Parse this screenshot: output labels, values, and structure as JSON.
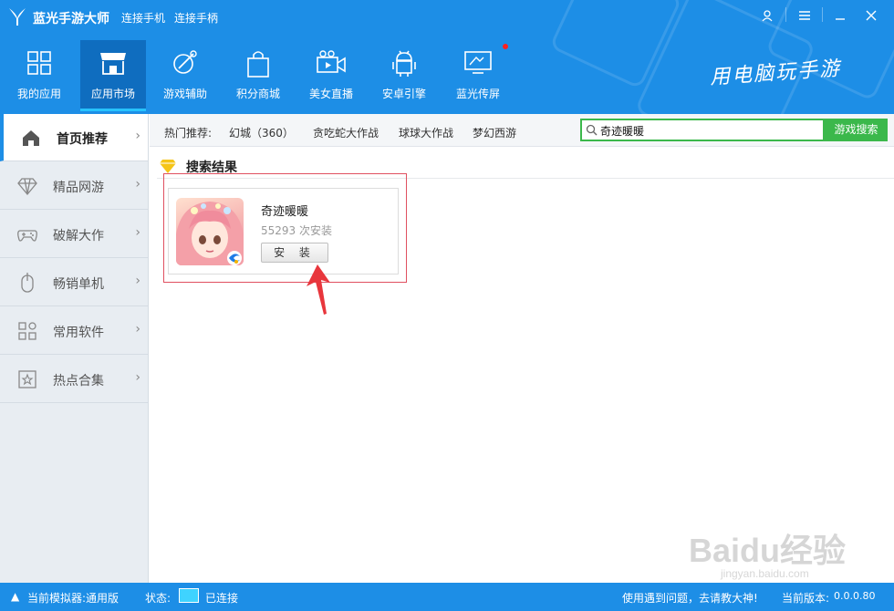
{
  "app": {
    "title": "蓝光手游大师",
    "links": [
      "连接手机",
      "连接手柄"
    ]
  },
  "nav": {
    "items": [
      {
        "label": "我的应用",
        "icon": "grid-icon"
      },
      {
        "label": "应用市场",
        "icon": "store-icon",
        "active": true
      },
      {
        "label": "游戏辅助",
        "icon": "tools-icon"
      },
      {
        "label": "积分商城",
        "icon": "shopping-bag-icon"
      },
      {
        "label": "美女直播",
        "icon": "video-camera-icon"
      },
      {
        "label": "安卓引擎",
        "icon": "android-icon"
      },
      {
        "label": "蓝光传屏",
        "icon": "screen-cast-icon",
        "badge_dot": true
      }
    ],
    "slogan": "用电脑玩手游"
  },
  "sidebar": {
    "items": [
      {
        "label": "首页推荐",
        "icon": "home-icon",
        "active": true
      },
      {
        "label": "精品网游",
        "icon": "diamond-icon"
      },
      {
        "label": "破解大作",
        "icon": "gamepad-icon"
      },
      {
        "label": "畅销单机",
        "icon": "mouse-icon"
      },
      {
        "label": "常用软件",
        "icon": "apps-icon"
      },
      {
        "label": "热点合集",
        "icon": "star-frame-icon"
      }
    ]
  },
  "hot": {
    "label": "热门推荐:",
    "items": [
      "幻城（360）",
      "贪吃蛇大作战",
      "球球大作战",
      "梦幻西游"
    ]
  },
  "search": {
    "value": "奇迹暖暖",
    "button": "游戏搜索"
  },
  "results": {
    "title": "搜索结果",
    "items": [
      {
        "name": "奇迹暖暖",
        "installs": "55293",
        "installs_suffix": "次安装",
        "button": "安 装"
      }
    ]
  },
  "status": {
    "emulator": "当前模拟器:通用版",
    "state_label": "状态:",
    "state_value": "已连接",
    "help": "使用遇到问题，去请教大神!",
    "version_label": "当前版本:",
    "version_value": "0.0.0.80"
  },
  "watermark": {
    "main": "Baidu经验",
    "sub": "jingyan.baidu.com"
  },
  "colors": {
    "header": "#1d8ee6",
    "search_green": "#3bb84b",
    "highlight_red": "#e05060"
  }
}
